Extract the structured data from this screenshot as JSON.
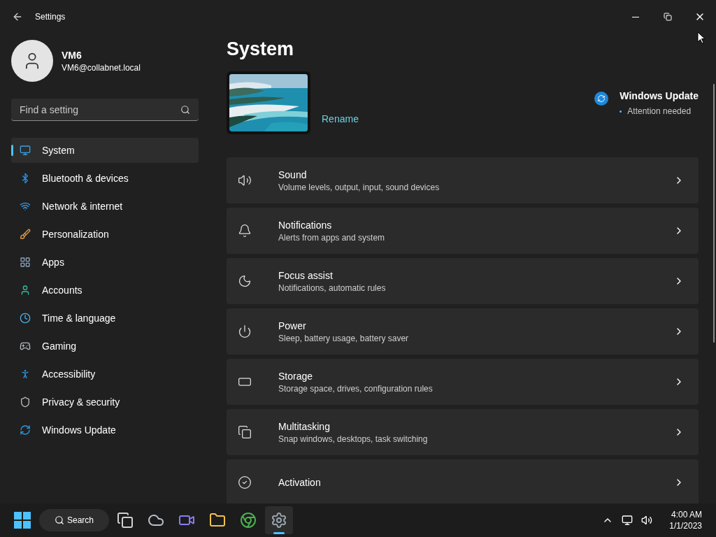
{
  "window": {
    "title": "Settings"
  },
  "account": {
    "name": "VM6",
    "email": "VM6@collabnet.local"
  },
  "search": {
    "placeholder": "Find a setting"
  },
  "sidebar": {
    "items": [
      {
        "label": "System",
        "selected": true
      },
      {
        "label": "Bluetooth & devices",
        "selected": false
      },
      {
        "label": "Network & internet",
        "selected": false
      },
      {
        "label": "Personalization",
        "selected": false
      },
      {
        "label": "Apps",
        "selected": false
      },
      {
        "label": "Accounts",
        "selected": false
      },
      {
        "label": "Time & language",
        "selected": false
      },
      {
        "label": "Gaming",
        "selected": false
      },
      {
        "label": "Accessibility",
        "selected": false
      },
      {
        "label": "Privacy & security",
        "selected": false
      },
      {
        "label": "Windows Update",
        "selected": false
      }
    ]
  },
  "page": {
    "title": "System",
    "rename": "Rename",
    "update": {
      "title": "Windows Update",
      "status": "Attention needed"
    }
  },
  "cards": [
    {
      "title": "Sound",
      "subtitle": "Volume levels, output, input, sound devices"
    },
    {
      "title": "Notifications",
      "subtitle": "Alerts from apps and system"
    },
    {
      "title": "Focus assist",
      "subtitle": "Notifications, automatic rules"
    },
    {
      "title": "Power",
      "subtitle": "Sleep, battery usage, battery saver"
    },
    {
      "title": "Storage",
      "subtitle": "Storage space, drives, configuration rules"
    },
    {
      "title": "Multitasking",
      "subtitle": "Snap windows, desktops, task switching"
    },
    {
      "title": "Activation"
    }
  ],
  "taskbar": {
    "search": "Search",
    "apps": [
      {
        "selected": false
      },
      {
        "selected": false
      },
      {
        "selected": false
      },
      {
        "selected": false
      },
      {
        "selected": false
      },
      {
        "selected": true
      }
    ],
    "time": "4:00 AM",
    "date": "1/1/2023"
  }
}
